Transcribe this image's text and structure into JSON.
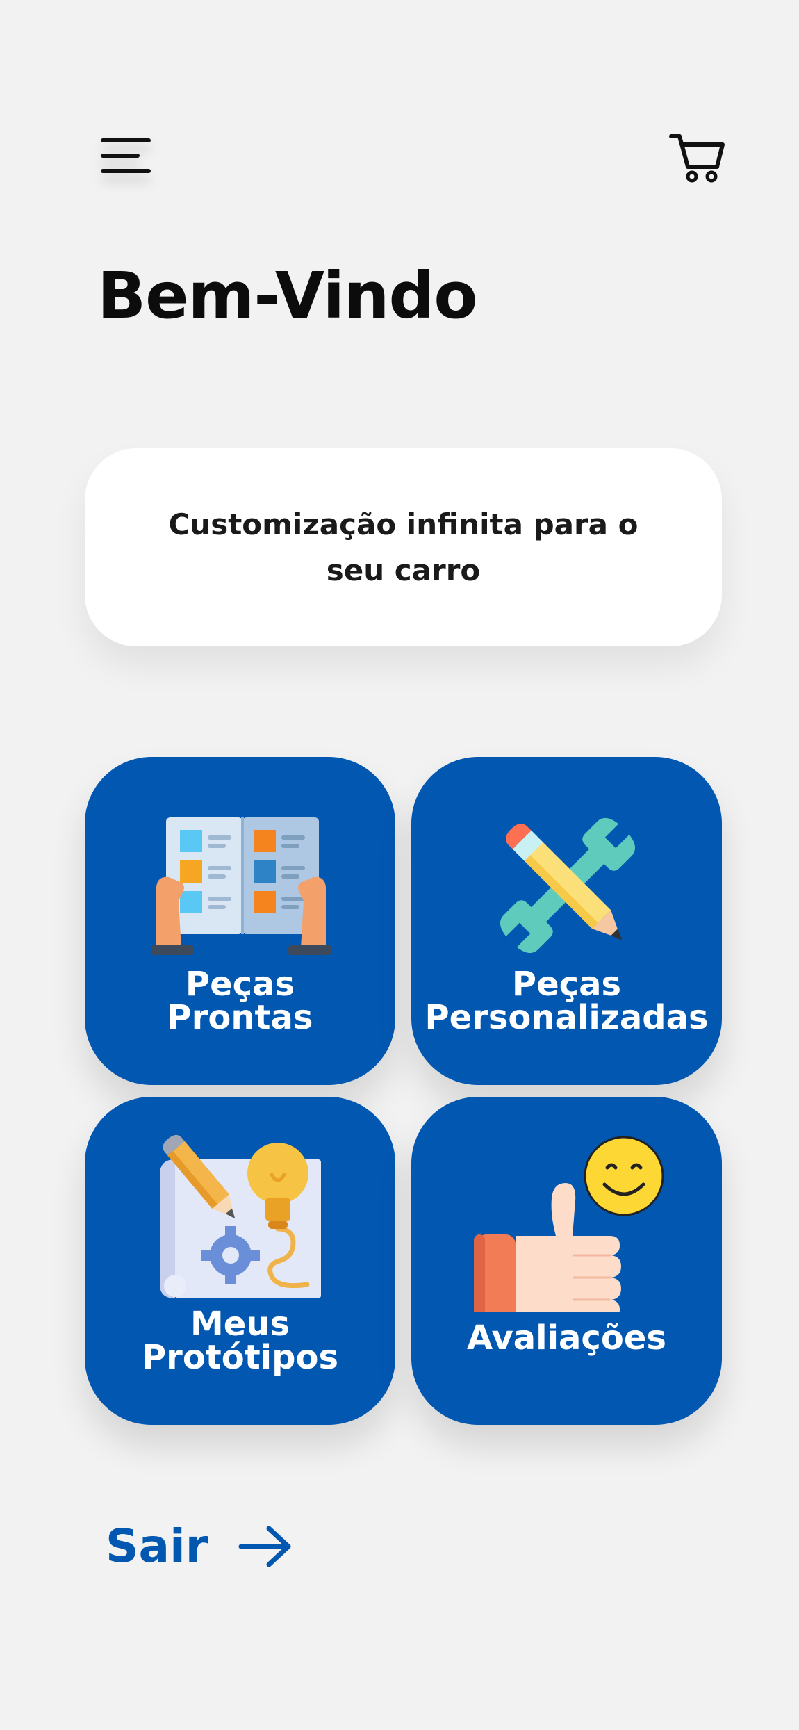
{
  "header": {
    "menu_icon": "hamburger-menu-icon",
    "cart_icon": "shopping-cart-icon"
  },
  "main": {
    "title": "Bem-Vindo",
    "tagline": "Customização infinita para o seu carro"
  },
  "tiles": [
    {
      "line1": "Peças",
      "line2": "Prontas",
      "icon": "catalog-book-icon"
    },
    {
      "line1": "Peças",
      "line2": "Personalizadas",
      "icon": "wrench-pencil-icon"
    },
    {
      "line1": "Meus",
      "line2": "Protótipos",
      "icon": "blueprint-idea-icon"
    },
    {
      "line1": "Avaliações",
      "icon": "thumbs-up-smiley-icon"
    }
  ],
  "footer": {
    "logout_label": "Sair",
    "logout_icon": "arrow-right-icon"
  },
  "colors": {
    "background": "#f2f2f2",
    "tile_blue": "#0257b1",
    "card_white": "#ffffff",
    "text_dark": "#0c0c0c"
  }
}
